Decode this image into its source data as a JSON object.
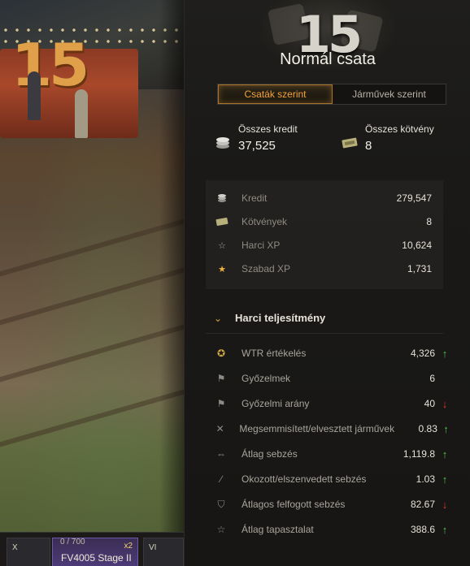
{
  "header": {
    "battle_count": "15",
    "battle_type": "Normál csata"
  },
  "tabs": [
    {
      "label": "Csaták szerint",
      "active": true
    },
    {
      "label": "Járművek szerint",
      "active": false
    }
  ],
  "summary": {
    "credit_label": "Összes kredit",
    "credit_value": "37,525",
    "bond_label": "Összes kötvény",
    "bond_value": "8"
  },
  "earnings": [
    {
      "icon": "credit-coins-icon",
      "label": "Kredit",
      "value": "279,547"
    },
    {
      "icon": "bond-icon",
      "label": "Kötvények",
      "value": "8"
    },
    {
      "icon": "combat-xp-star-icon",
      "label": "Harci XP",
      "value": "10,624"
    },
    {
      "icon": "free-xp-star-icon",
      "label": "Szabad XP",
      "value": "1,731"
    }
  ],
  "performance": {
    "title": "Harci teljesítmény",
    "rows": [
      {
        "icon": "wtr-laurel-icon",
        "label": "WTR értékelés",
        "value": "4,326",
        "trend": "up"
      },
      {
        "icon": "victory-flag-icon",
        "label": "Győzelmek",
        "value": "6",
        "trend": ""
      },
      {
        "icon": "victory-flag-icon",
        "label": "Győzelmi arány",
        "value": "40",
        "trend": "down"
      },
      {
        "icon": "destroyed-tank-icon",
        "label": "Megsemmisített/elvesztett járművek",
        "value": "0.83",
        "trend": "up"
      },
      {
        "icon": "average-damage-icon",
        "label": "Átlag sebzés",
        "value": "1,119.8",
        "trend": "up"
      },
      {
        "icon": "damage-ratio-icon",
        "label": "Okozott/elszenvedett sebzés",
        "value": "1.03",
        "trend": "up"
      },
      {
        "icon": "blocked-damage-shield-icon",
        "label": "Átlagos felfogott sebzés",
        "value": "82.67",
        "trend": "down"
      },
      {
        "icon": "average-xp-star-icon",
        "label": "Átlag tapasztalat",
        "value": "388.6",
        "trend": "up"
      }
    ]
  },
  "carousel": {
    "xp_progress": "0 / 700",
    "vehicles": [
      {
        "tier": "X",
        "name": "",
        "badge": ""
      },
      {
        "tier": "",
        "name": "FV4005 Stage II",
        "badge": "x2"
      },
      {
        "tier": "VI",
        "name": "",
        "badge": ""
      }
    ]
  },
  "colors": {
    "accent_orange": "#f3a33a",
    "trend_up": "#4cc24a",
    "trend_down": "#e0362d"
  }
}
